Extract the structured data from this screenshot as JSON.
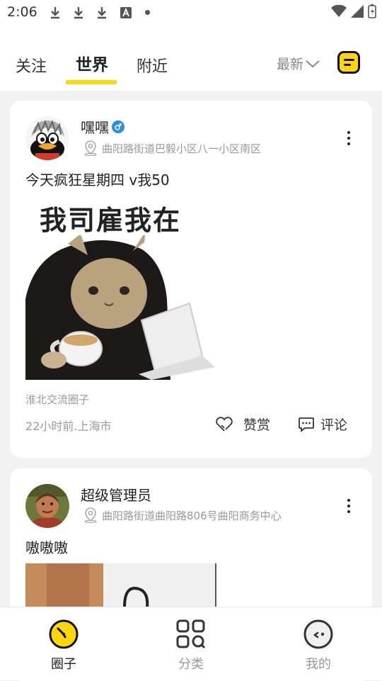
{
  "status_bar": {
    "time": "2:06"
  },
  "top_nav": {
    "tabs": [
      {
        "label": "关注"
      },
      {
        "label": "世界"
      },
      {
        "label": "附近"
      }
    ],
    "sort_label": "最新"
  },
  "posts": [
    {
      "username": "嘿嘿",
      "location": "曲阳路街道巴毅小区八一小区南区",
      "text": "今天疯狂星期四 v我50",
      "image_caption": "我司雇我在",
      "circle": "淮北交流圈子",
      "time": "22小时前.上海市",
      "like_label": "赞赏",
      "comment_label": "评论"
    },
    {
      "username": "超级管理员",
      "location": "曲阳路街道曲阳路806号曲阳商务中心",
      "text": "嗷嗷嗷"
    }
  ],
  "bottom_nav": {
    "items": [
      {
        "label": "圈子"
      },
      {
        "label": "分类"
      },
      {
        "label": "我的"
      }
    ]
  },
  "colors": {
    "accent": "#ffd60a",
    "verified": "#2a8cf0"
  }
}
